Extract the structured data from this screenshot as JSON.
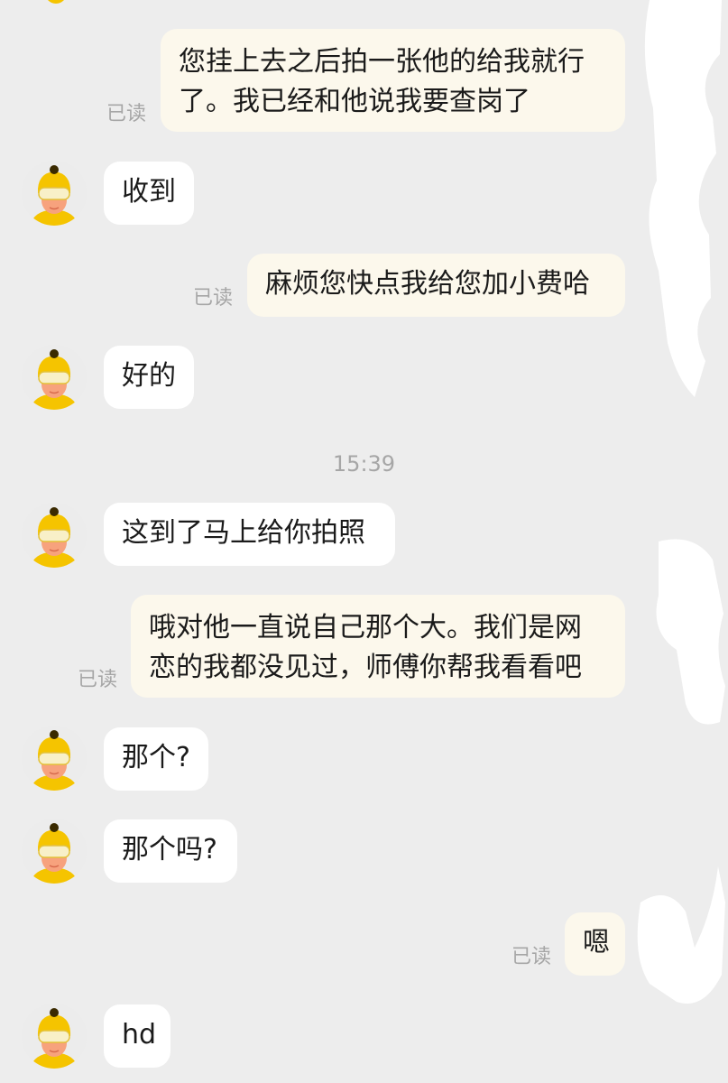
{
  "chat": {
    "read_label": "已读",
    "timestamp": "15:39",
    "messages": [
      {
        "text": "您挂上去之后拍一张他的给我就行了。我已经和他说我要查岗了"
      },
      {
        "text": "收到"
      },
      {
        "text": "麻烦您快点我给您加小费哈"
      },
      {
        "text": "好的"
      },
      {
        "text": "这到了马上给你拍照"
      },
      {
        "text": "哦对他一直说自己那个大。我们是网恋的我都没见过，师傅你帮我看看吧"
      },
      {
        "text": "那个?"
      },
      {
        "text": "那个吗?"
      },
      {
        "text": "嗯"
      },
      {
        "text": "hd"
      }
    ]
  },
  "colors": {
    "background": "#ededed",
    "outgoing_bubble": "#fcf8ec",
    "incoming_bubble": "#ffffff",
    "read_receipt": "#a6a6a6",
    "avatar_accent": "#f5c400"
  },
  "icons": {
    "avatar": "courier-avatar-icon"
  }
}
